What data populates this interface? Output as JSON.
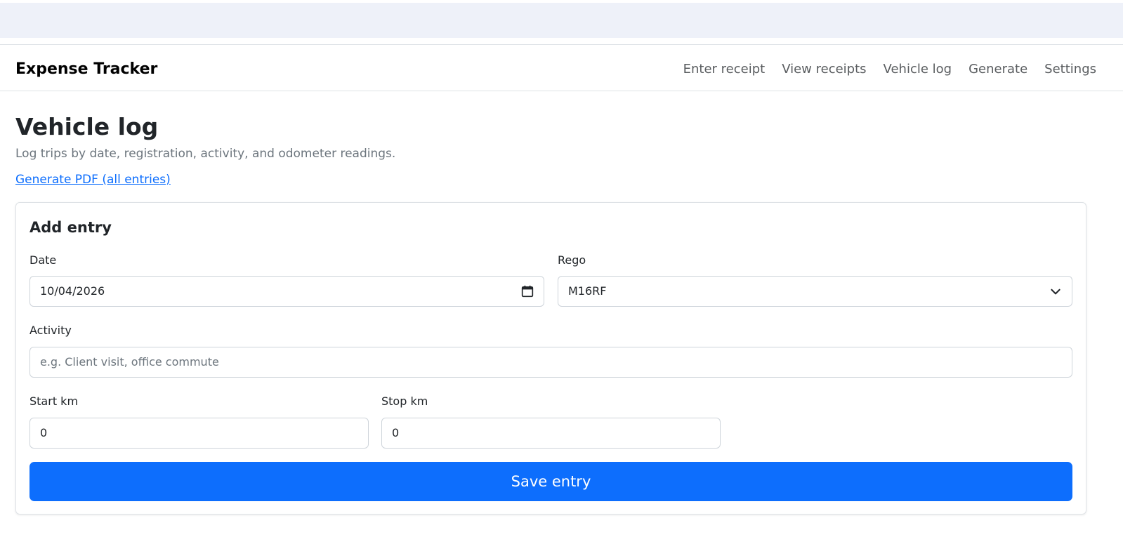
{
  "app": {
    "brand": "Expense Tracker"
  },
  "nav": {
    "items": [
      {
        "label": "Enter receipt"
      },
      {
        "label": "View receipts"
      },
      {
        "label": "Vehicle log"
      },
      {
        "label": "Generate"
      },
      {
        "label": "Settings"
      }
    ]
  },
  "page": {
    "title": "Vehicle log",
    "subtitle": "Log trips by date, registration, activity, and odometer readings.",
    "pdf_link": "Generate PDF (all entries)"
  },
  "form": {
    "title": "Add entry",
    "date": {
      "label": "Date",
      "value": "10/04/2026",
      "icon": "calendar-icon"
    },
    "rego": {
      "label": "Rego",
      "value": "M16RF",
      "icon": "chevron-down-icon"
    },
    "activity": {
      "label": "Activity",
      "value": "",
      "placeholder": "e.g. Client visit, office commute"
    },
    "start_km": {
      "label": "Start km",
      "value": "0"
    },
    "stop_km": {
      "label": "Stop km",
      "value": "0"
    },
    "save_label": "Save entry"
  },
  "colors": {
    "primary": "#0d6efd",
    "top_strip": "#eef1f9",
    "muted_text": "#6c757d"
  }
}
